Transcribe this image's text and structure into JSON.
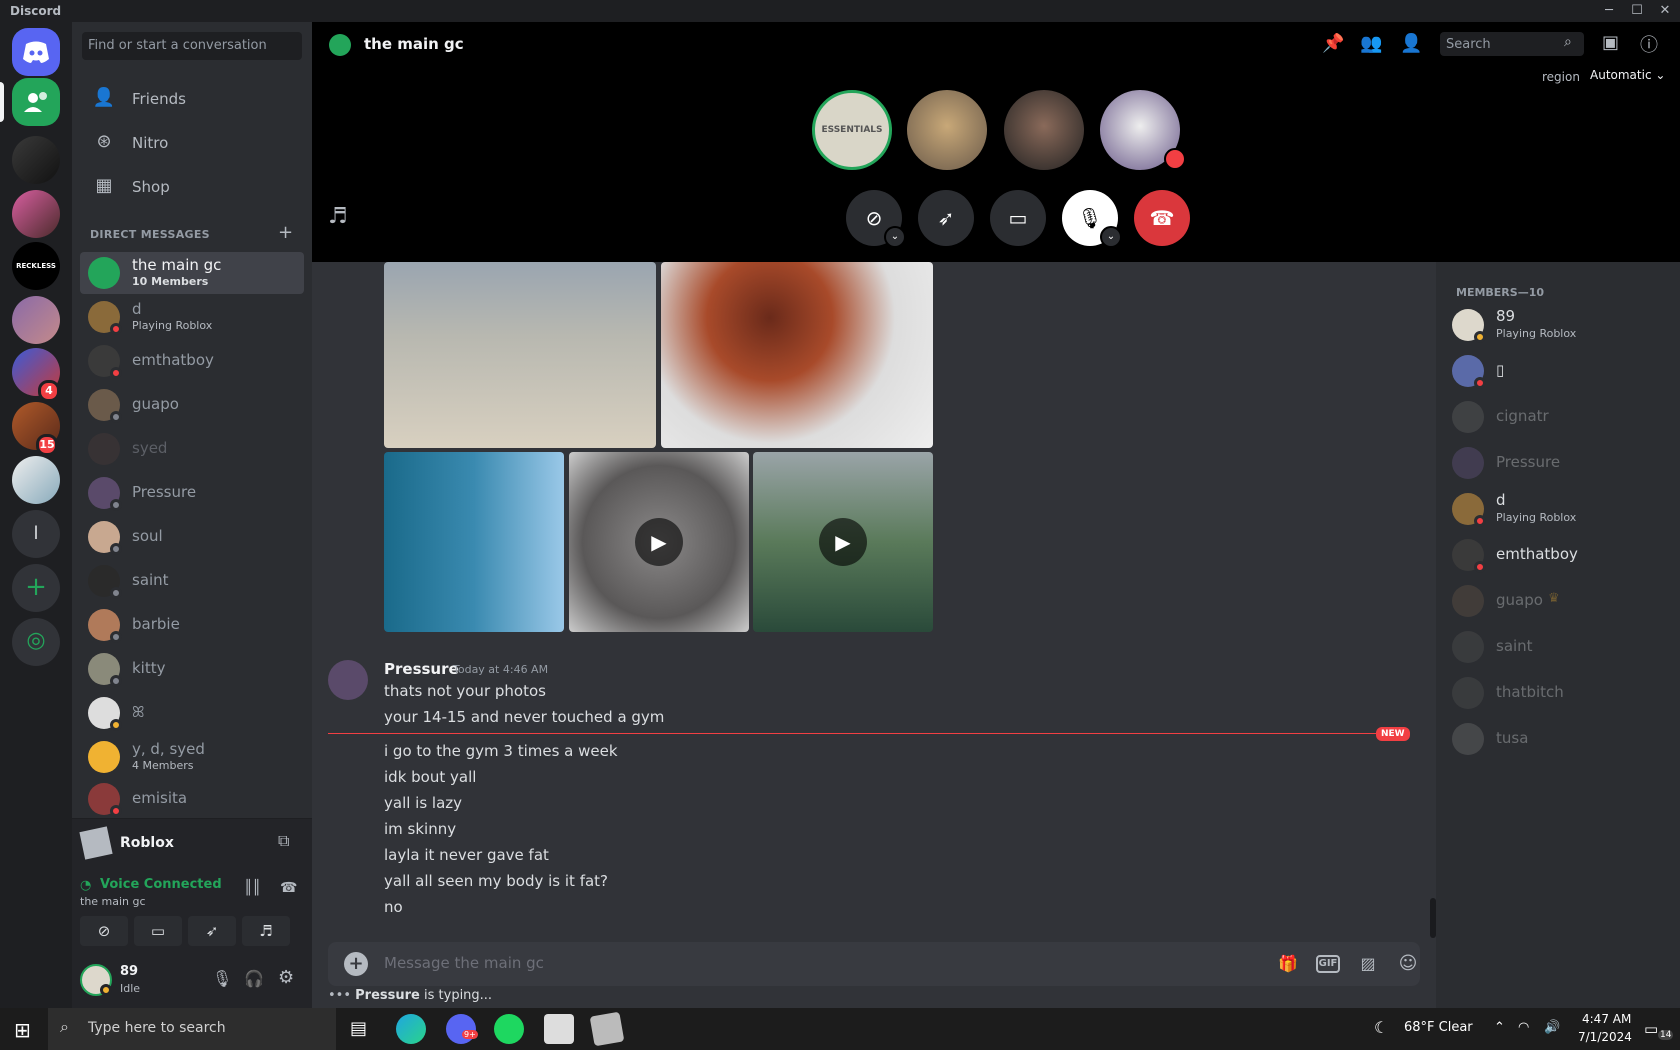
{
  "window": {
    "title": "Discord"
  },
  "sidebar": {
    "search_placeholder": "Find or start a conversation",
    "nav": [
      {
        "label": "Friends"
      },
      {
        "label": "Nitro"
      },
      {
        "label": "Shop"
      }
    ],
    "dm_header": "DIRECT MESSAGES",
    "dms": [
      {
        "name": "the main gc",
        "sub": "10 Members"
      },
      {
        "name": "d",
        "sub": "Playing Roblox"
      },
      {
        "name": "emthatboy"
      },
      {
        "name": "guapo"
      },
      {
        "name": "syed"
      },
      {
        "name": "Pressure"
      },
      {
        "name": "soul"
      },
      {
        "name": "saint"
      },
      {
        "name": "barbie"
      },
      {
        "name": "kitty"
      },
      {
        "name": "ꕤ"
      },
      {
        "name": "y, d, syed",
        "sub": "4 Members"
      },
      {
        "name": "emisita"
      }
    ],
    "servers": {
      "badge1": "4",
      "badge2": "15",
      "letter": "l",
      "reckless": "RECKLESS"
    }
  },
  "activity": {
    "game": "Roblox"
  },
  "voice": {
    "status": "Voice Connected",
    "channel": "the main gc"
  },
  "user": {
    "name": "89",
    "status": "Idle"
  },
  "header": {
    "channel": "the main gc",
    "search_placeholder": "Search",
    "region_label": "region",
    "region_value": "Automatic"
  },
  "call": {
    "avatar1_text": "ESSENTIALS"
  },
  "chat": {
    "author": "Pressure",
    "timestamp": "Today at 4:46 AM",
    "lines_before": [
      "thats not your photos",
      "your 14-15 and never touched a gym"
    ],
    "new_label": "NEW",
    "lines_after": [
      "i go to the gym 3 times a week",
      "idk bout yall",
      "yall is lazy",
      "im skinny",
      "layla it never gave fat",
      "yall all seen my body is it fat?",
      "no"
    ],
    "composer_placeholder": "Message the main gc",
    "typing_user": "Pressure",
    "typing_suffix": " is typing..."
  },
  "members": {
    "header": "MEMBERS—10",
    "list": [
      {
        "name": "89",
        "sub": "Playing Roblox"
      },
      {
        "name": "▯"
      },
      {
        "name": "cignatr"
      },
      {
        "name": "Pressure"
      },
      {
        "name": "d",
        "sub": "Playing Roblox"
      },
      {
        "name": "emthatboy"
      },
      {
        "name": "guapo"
      },
      {
        "name": "saint"
      },
      {
        "name": "thatbitch"
      },
      {
        "name": "tusa"
      }
    ]
  },
  "taskbar": {
    "search_placeholder": "Type here to search",
    "weather": "68°F  Clear",
    "time": "4:47 AM",
    "date": "7/1/2024",
    "notif": "14",
    "discord_badge": "9+"
  },
  "colors": {
    "accent": "#5865f2",
    "green": "#23a55a",
    "red": "#f23f43",
    "bg": "#313338"
  }
}
